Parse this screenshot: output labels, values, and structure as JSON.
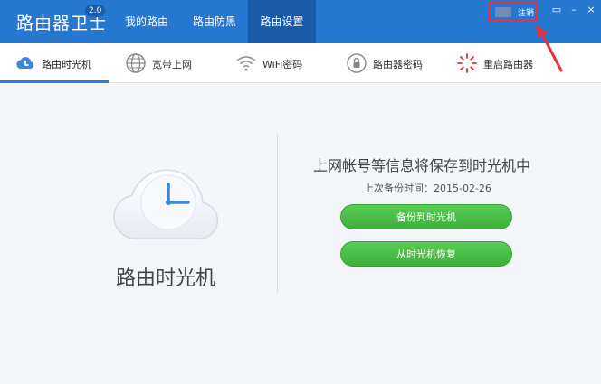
{
  "app": {
    "title": "路由器卫士",
    "version": "2.0"
  },
  "nav": {
    "tabs": [
      {
        "label": "我的路由"
      },
      {
        "label": "路由防黑"
      },
      {
        "label": "路由设置"
      }
    ],
    "active_index": 2
  },
  "user": {
    "logout_label": "注销"
  },
  "window_controls": {
    "restore": "▭",
    "minimize": "–",
    "close": "×"
  },
  "subnav": {
    "items": [
      {
        "label": "路由时光机",
        "icon": "time-machine-cloud-icon"
      },
      {
        "label": "宽带上网",
        "icon": "globe-icon"
      },
      {
        "label": "WiFi密码",
        "icon": "wifi-icon"
      },
      {
        "label": "路由器密码",
        "icon": "lock-icon"
      },
      {
        "label": "重启路由器",
        "icon": "restart-icon"
      }
    ],
    "active_index": 0
  },
  "main": {
    "hero_label": "路由时光机",
    "info_title": "上网帐号等信息将保存到时光机中",
    "last_backup": "上次备份时间：2015-02-26",
    "backup_button": "备份到时光机",
    "restore_button": "从时光机恢复"
  },
  "colors": {
    "header": "#2577cf",
    "active_tab": "#1a5ba8",
    "accent": "#2b7fd7",
    "button_green": "#4cbf4a",
    "highlight_red": "#e3333b"
  }
}
